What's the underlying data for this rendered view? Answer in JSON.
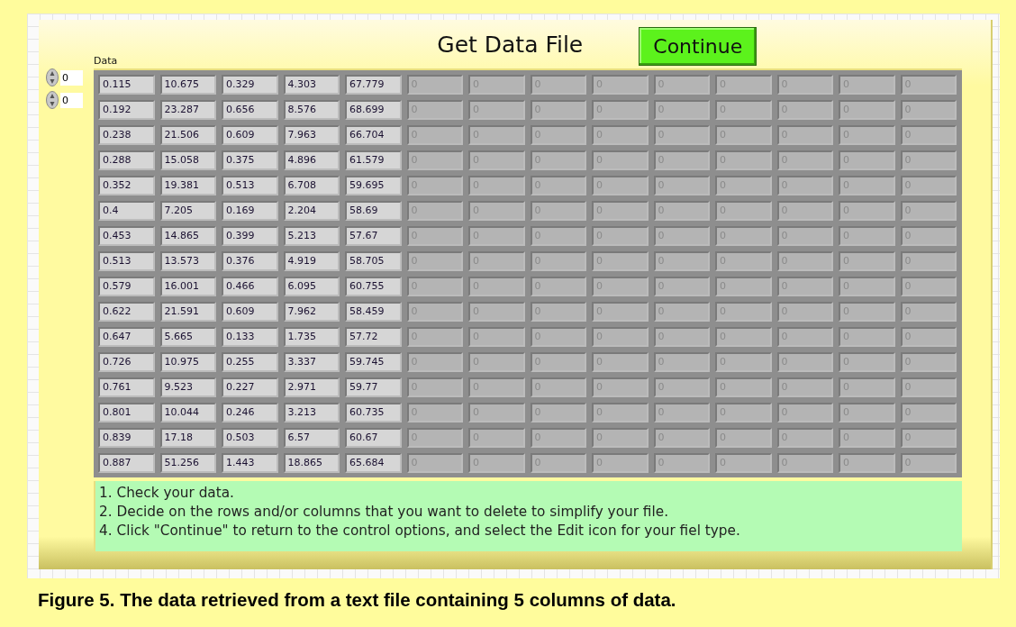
{
  "title": "Get Data File",
  "continue_button": {
    "label": "Continue"
  },
  "array": {
    "label": "Data",
    "indices": [
      "0",
      "0"
    ],
    "columns": [
      {
        "disabled": false
      },
      {
        "disabled": false
      },
      {
        "disabled": false
      },
      {
        "disabled": false
      },
      {
        "disabled": false
      },
      {
        "disabled": true
      },
      {
        "disabled": true
      },
      {
        "disabled": true
      },
      {
        "disabled": true
      },
      {
        "disabled": true
      },
      {
        "disabled": true
      },
      {
        "disabled": true
      },
      {
        "disabled": true
      },
      {
        "disabled": true
      }
    ],
    "rows": [
      [
        "0.115",
        "10.675",
        "0.329",
        "4.303",
        "67.779",
        "0",
        "0",
        "0",
        "0",
        "0",
        "0",
        "0",
        "0",
        "0"
      ],
      [
        "0.192",
        "23.287",
        "0.656",
        "8.576",
        "68.699",
        "0",
        "0",
        "0",
        "0",
        "0",
        "0",
        "0",
        "0",
        "0"
      ],
      [
        "0.238",
        "21.506",
        "0.609",
        "7.963",
        "66.704",
        "0",
        "0",
        "0",
        "0",
        "0",
        "0",
        "0",
        "0",
        "0"
      ],
      [
        "0.288",
        "15.058",
        "0.375",
        "4.896",
        "61.579",
        "0",
        "0",
        "0",
        "0",
        "0",
        "0",
        "0",
        "0",
        "0"
      ],
      [
        "0.352",
        "19.381",
        "0.513",
        "6.708",
        "59.695",
        "0",
        "0",
        "0",
        "0",
        "0",
        "0",
        "0",
        "0",
        "0"
      ],
      [
        "0.4",
        "7.205",
        "0.169",
        "2.204",
        "58.69",
        "0",
        "0",
        "0",
        "0",
        "0",
        "0",
        "0",
        "0",
        "0"
      ],
      [
        "0.453",
        "14.865",
        "0.399",
        "5.213",
        "57.67",
        "0",
        "0",
        "0",
        "0",
        "0",
        "0",
        "0",
        "0",
        "0"
      ],
      [
        "0.513",
        "13.573",
        "0.376",
        "4.919",
        "58.705",
        "0",
        "0",
        "0",
        "0",
        "0",
        "0",
        "0",
        "0",
        "0"
      ],
      [
        "0.579",
        "16.001",
        "0.466",
        "6.095",
        "60.755",
        "0",
        "0",
        "0",
        "0",
        "0",
        "0",
        "0",
        "0",
        "0"
      ],
      [
        "0.622",
        "21.591",
        "0.609",
        "7.962",
        "58.459",
        "0",
        "0",
        "0",
        "0",
        "0",
        "0",
        "0",
        "0",
        "0"
      ],
      [
        "0.647",
        "5.665",
        "0.133",
        "1.735",
        "57.72",
        "0",
        "0",
        "0",
        "0",
        "0",
        "0",
        "0",
        "0",
        "0"
      ],
      [
        "0.726",
        "10.975",
        "0.255",
        "3.337",
        "59.745",
        "0",
        "0",
        "0",
        "0",
        "0",
        "0",
        "0",
        "0",
        "0"
      ],
      [
        "0.761",
        "9.523",
        "0.227",
        "2.971",
        "59.77",
        "0",
        "0",
        "0",
        "0",
        "0",
        "0",
        "0",
        "0",
        "0"
      ],
      [
        "0.801",
        "10.044",
        "0.246",
        "3.213",
        "60.735",
        "0",
        "0",
        "0",
        "0",
        "0",
        "0",
        "0",
        "0",
        "0"
      ],
      [
        "0.839",
        "17.18",
        "0.503",
        "6.57",
        "60.67",
        "0",
        "0",
        "0",
        "0",
        "0",
        "0",
        "0",
        "0",
        "0"
      ],
      [
        "0.887",
        "51.256",
        "1.443",
        "18.865",
        "65.684",
        "0",
        "0",
        "0",
        "0",
        "0",
        "0",
        "0",
        "0",
        "0"
      ]
    ]
  },
  "instructions": [
    "1. Check your data.",
    "2. Decide on the rows and/or columns that you want to delete to simplify your file.",
    "4. Click \"Continue\" to return to the control options, and select the Edit icon for your fiel type."
  ],
  "caption": "Figure 5. The data retrieved from a text file containing 5 columns of data."
}
